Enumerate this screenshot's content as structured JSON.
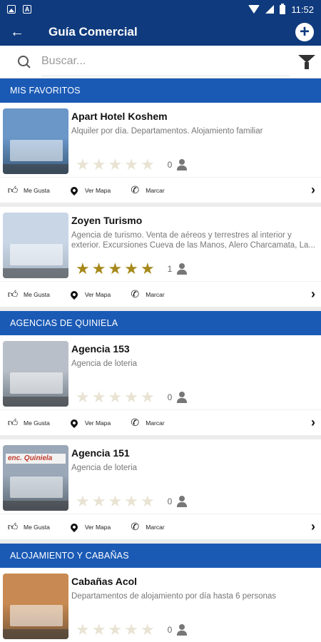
{
  "statusbar": {
    "time": "11:52"
  },
  "appbar": {
    "title": "Guía Comercial"
  },
  "search": {
    "placeholder": "Buscar..."
  },
  "sections": [
    {
      "title": "MIS FAVORITOS",
      "items": [
        {
          "name": "Apart Hotel Koshem",
          "description": "Alquiler por día.  Departamentos. Alojamiento familiar",
          "stars": 0,
          "count": "0",
          "like_label": "Me Gusta",
          "map_label": "Ver Mapa",
          "call_label": "Marcar"
        },
        {
          "name": "Zoyen Turismo",
          "description": "Agencia de turismo. Venta de aéreos y terrestres al interior y exterior. Excursiones Cueva de las Manos, Alero Charcamata, La...",
          "stars": 5,
          "count": "1",
          "like_label": "Me Gusta",
          "map_label": "Ver Mapa",
          "call_label": "Marcar"
        }
      ]
    },
    {
      "title": "AGENCIAS DE QUINIELA",
      "items": [
        {
          "name": "Agencia 153",
          "description": "Agencia de loteria",
          "stars": 0,
          "count": "0",
          "like_label": "Me Gusta",
          "map_label": "Ver Mapa",
          "call_label": "Marcar"
        },
        {
          "name": "Agencia 151",
          "description": "Agencia de loteria",
          "stars": 0,
          "count": "0",
          "like_label": "Me Gusta",
          "map_label": "Ver Mapa",
          "call_label": "Marcar"
        }
      ]
    },
    {
      "title": "ALOJAMIENTO Y CABAÑAS",
      "items": [
        {
          "name": "Cabañas Acol",
          "description": "Departamentos de alojamiento por día hasta 6 personas",
          "stars": 0,
          "count": "0",
          "like_label": "Me Gusta",
          "map_label": "Ver Mapa",
          "call_label": "Marcar"
        }
      ]
    }
  ],
  "thumbnail_signs": {
    "agencia_151_sign": "enc. Quiniela"
  }
}
